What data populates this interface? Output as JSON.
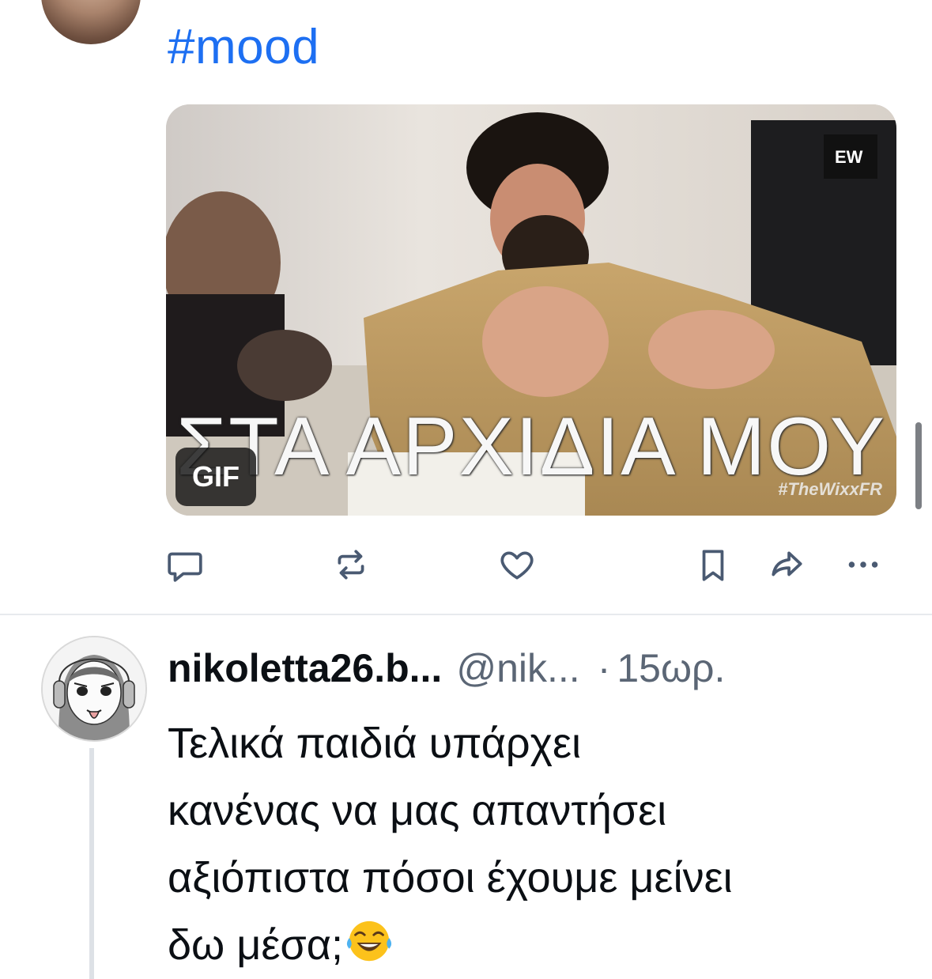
{
  "previous_post": {
    "hashtag": "#mood",
    "media": {
      "caption": "ΣΤΑ ΑΡΧΙΔΙΑ ΜΟΥ",
      "watermark": "#TheWixxFR",
      "badge": "GIF"
    },
    "actions": [
      {
        "name": "reply",
        "icon": "speech-bubble-icon"
      },
      {
        "name": "repost",
        "icon": "repost-arrows-icon"
      },
      {
        "name": "like",
        "icon": "heart-icon"
      },
      {
        "name": "bookmark",
        "icon": "bookmark-icon"
      },
      {
        "name": "share",
        "icon": "share-arrow-icon"
      },
      {
        "name": "more",
        "icon": "ellipsis-icon"
      }
    ]
  },
  "post": {
    "display_name": "nikoletta26.b...",
    "handle": "@nik...",
    "separator": "·",
    "time": "15ωρ.",
    "text": "Τελικά παιδιά υπάρχει\nκανένας να μας απαντήσει\nαξιόπιστα πόσοι έχουμε μείνει\nδω μέσα;",
    "emoji": "face-with-tears-of-joy"
  },
  "colors": {
    "accent": "#1d6ff2",
    "icon": "#4a5a72",
    "muted_text": "#5b6675",
    "divider": "#e7eaee"
  }
}
